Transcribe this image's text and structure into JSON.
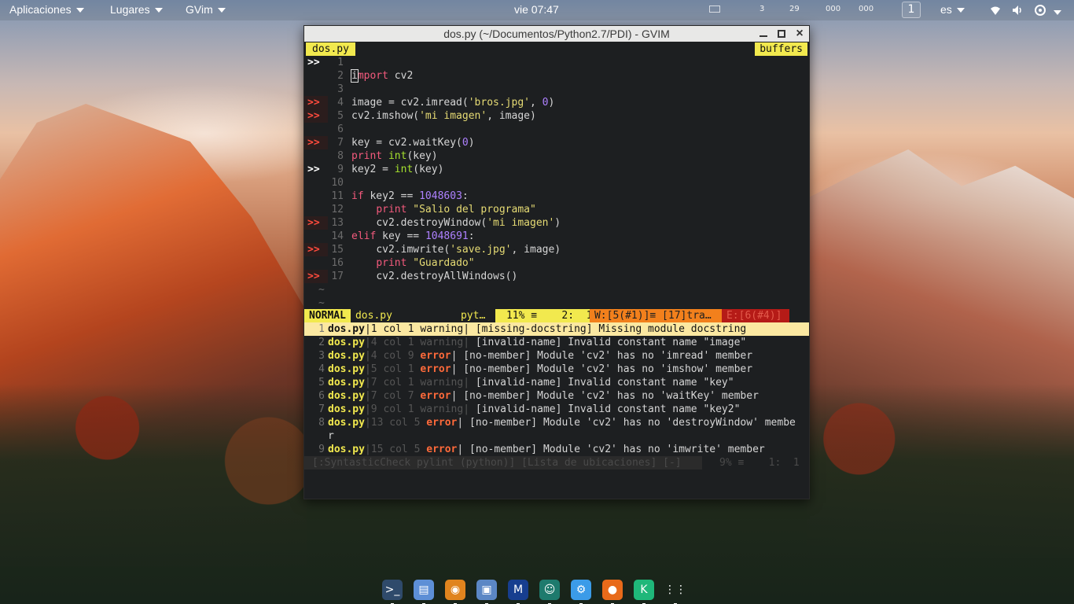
{
  "topbar": {
    "applications": "Aplicaciones",
    "places": "Lugares",
    "app_menu": "GVim",
    "clock": "vie 07:47",
    "indicators": [
      "3",
      "29",
      "000",
      "000"
    ],
    "workspace": "1",
    "keyboard_layout": "es"
  },
  "window": {
    "title": "dos.py (~/Documentos/Python2.7/PDI) - GVIM"
  },
  "tabline": {
    "active_tab": "dos.py",
    "right_label": "buffers"
  },
  "editor": {
    "lines": [
      {
        "n": "1",
        "sign": ">>",
        "type": "warn"
      },
      {
        "n": "2",
        "sign": "",
        "type": "none"
      },
      {
        "n": "3",
        "sign": "",
        "type": "none"
      },
      {
        "n": "4",
        "sign": ">>",
        "type": "err"
      },
      {
        "n": "5",
        "sign": ">>",
        "type": "err"
      },
      {
        "n": "6",
        "sign": "",
        "type": "none"
      },
      {
        "n": "7",
        "sign": ">>",
        "type": "err"
      },
      {
        "n": "8",
        "sign": "",
        "type": "none"
      },
      {
        "n": "9",
        "sign": ">>",
        "type": "warn"
      },
      {
        "n": "10",
        "sign": "",
        "type": "none"
      },
      {
        "n": "11",
        "sign": "",
        "type": "none"
      },
      {
        "n": "12",
        "sign": "",
        "type": "none"
      },
      {
        "n": "13",
        "sign": ">>",
        "type": "err"
      },
      {
        "n": "14",
        "sign": "",
        "type": "none"
      },
      {
        "n": "15",
        "sign": ">>",
        "type": "err"
      },
      {
        "n": "16",
        "sign": "",
        "type": "none"
      },
      {
        "n": "17",
        "sign": ">>",
        "type": "err"
      }
    ],
    "code": {
      "l2_kw": "import",
      "l2_rest": " cv2",
      "l4_a": "image = cv2.imread(",
      "l4_s": "'bros.jpg'",
      "l4_b": ", ",
      "l4_n": "0",
      "l4_c": ")",
      "l5_a": "cv2.imshow(",
      "l5_s": "'mi imagen'",
      "l5_b": ", image)",
      "l7_a": "key = cv2.waitKey(",
      "l7_n": "0",
      "l7_b": ")",
      "l8_kw": "print",
      "l8_sp": " ",
      "l8_bi": "int",
      "l8_b": "(key)",
      "l9_a": "key2 = ",
      "l9_bi": "int",
      "l9_b": "(key)",
      "l11_kw": "if",
      "l11_a": " key2 == ",
      "l11_n": "1048603",
      "l11_b": ":",
      "l12_ind": "    ",
      "l12_kw": "print",
      "l12_s": " \"Salio del programa\"",
      "l13_ind": "    ",
      "l13_a": "cv2.destroyWindow(",
      "l13_s": "'mi imagen'",
      "l13_b": ")",
      "l14_kw": "elif",
      "l14_a": " key == ",
      "l14_n": "1048691",
      "l14_b": ":",
      "l15_ind": "    ",
      "l15_a": "cv2.imwrite(",
      "l15_s": "'save.jpg'",
      "l15_b": ", image)",
      "l16_ind": "    ",
      "l16_kw": "print",
      "l16_s": " \"Guardado\"",
      "l17_ind": "    ",
      "l17_a": "cv2.destroyAllWindows()"
    },
    "tilde": "~"
  },
  "statusline": {
    "mode": "NORMAL",
    "file": "dos.py",
    "filetype": "pyt…",
    "percent": "11% ≡    2:  1",
    "warnings": "W:[5(#1)]≡ [17]tra…",
    "errors": "E:[6(#4)]"
  },
  "loclist": {
    "rows": [
      {
        "n": "1",
        "file": "dos.py",
        "pos": "|1 col 1 warning|",
        "tag": "",
        "msg": " [missing-docstring] Missing module docstring",
        "selected": true
      },
      {
        "n": "2",
        "file": "dos.py",
        "pos": "|4 col 1 warning|",
        "tag": "",
        "msg": " [invalid-name] Invalid constant name \"image\""
      },
      {
        "n": "3",
        "file": "dos.py",
        "pos": "|4 col 9 ",
        "tag": "error",
        "msg": "| [no-member] Module 'cv2' has no 'imread' member"
      },
      {
        "n": "4",
        "file": "dos.py",
        "pos": "|5 col 1 ",
        "tag": "error",
        "msg": "| [no-member] Module 'cv2' has no 'imshow' member"
      },
      {
        "n": "5",
        "file": "dos.py",
        "pos": "|7 col 1 warning|",
        "tag": "",
        "msg": " [invalid-name] Invalid constant name \"key\""
      },
      {
        "n": "6",
        "file": "dos.py",
        "pos": "|7 col 7 ",
        "tag": "error",
        "msg": "| [no-member] Module 'cv2' has no 'waitKey' member"
      },
      {
        "n": "7",
        "file": "dos.py",
        "pos": "|9 col 1 warning|",
        "tag": "",
        "msg": " [invalid-name] Invalid constant name \"key2\""
      },
      {
        "n": "8",
        "file": "dos.py",
        "pos": "|13 col 5 ",
        "tag": "error",
        "msg": "| [no-member] Module 'cv2' has no 'destroyWindow' membe"
      },
      {
        "n": "",
        "file": "",
        "pos": "",
        "tag": "",
        "msg": "r"
      },
      {
        "n": "9",
        "file": "dos.py",
        "pos": "|15 col 5 ",
        "tag": "error",
        "msg": "| [no-member] Module 'cv2' has no 'imwrite' member"
      }
    ]
  },
  "bottom_status": {
    "left": "[:SyntasticCheck pylint (python)] [Lista de ubicaciones] [-]",
    "right": "9% ≡    1:  1"
  },
  "dock": {
    "items": [
      {
        "name": "terminal-icon",
        "glyph": ">_",
        "color": "#2f4a6b"
      },
      {
        "name": "files-icon",
        "glyph": "▤",
        "color": "#5d8fd6"
      },
      {
        "name": "blender-icon",
        "glyph": "◉",
        "color": "#e0841e"
      },
      {
        "name": "virtualbox-icon",
        "glyph": "▣",
        "color": "#5b87c5"
      },
      {
        "name": "malwarebytes-icon",
        "glyph": "M",
        "color": "#173e8f"
      },
      {
        "name": "teacher-icon",
        "glyph": "☺",
        "color": "#1e7a6d"
      },
      {
        "name": "settings-icon",
        "glyph": "⚙",
        "color": "#3b9be8"
      },
      {
        "name": "firefox-icon",
        "glyph": "●",
        "color": "#e86a1a"
      },
      {
        "name": "kotlin-icon",
        "glyph": "K",
        "color": "#1fb77a"
      },
      {
        "name": "app-grid-icon",
        "glyph": "⋮⋮",
        "color": "transparent"
      }
    ]
  }
}
